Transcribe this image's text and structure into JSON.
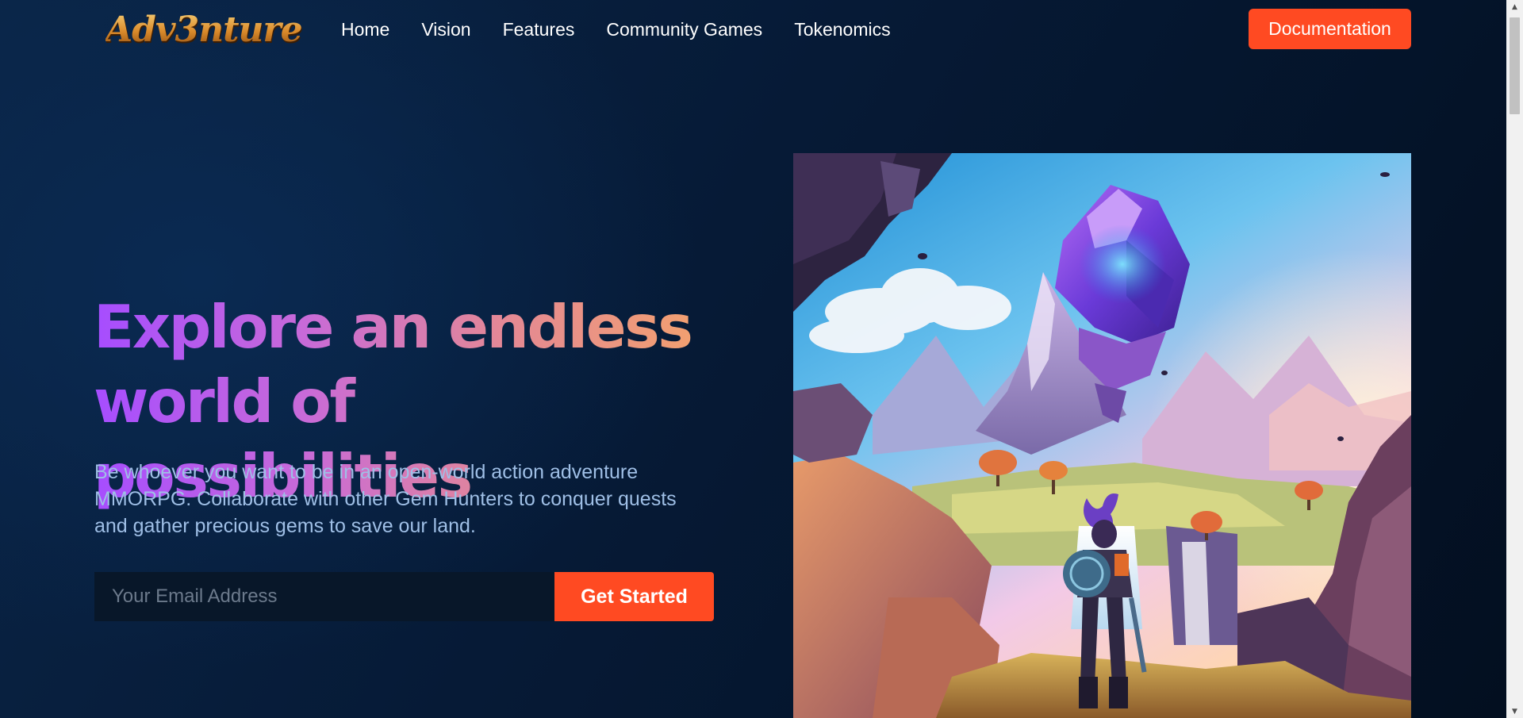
{
  "brand": {
    "logo_text": "Adv3nture"
  },
  "nav": {
    "links": [
      {
        "label": "Home"
      },
      {
        "label": "Vision"
      },
      {
        "label": "Features"
      },
      {
        "label": "Community Games"
      },
      {
        "label": "Tokenomics"
      }
    ],
    "cta_label": "Documentation"
  },
  "hero": {
    "title_line1": "Explore an endless",
    "title_line2": "world of possibilities",
    "subtitle": "Be whoever you want to be in an open-world action adventure MMORPG. Collaborate with other Gem Hunters to conquer quests and gather precious gems to save our land.",
    "email_placeholder": "Your Email Address",
    "email_value": "",
    "cta_label": "Get Started"
  },
  "colors": {
    "accent": "#ff4a22",
    "background": "#061a36",
    "title_gradient_start": "#a64dff",
    "title_gradient_end": "#f2a070",
    "subtitle": "#9fbfe6"
  },
  "scrollbar": {
    "up_icon": "triangle-up-icon",
    "down_icon": "triangle-down-icon"
  }
}
